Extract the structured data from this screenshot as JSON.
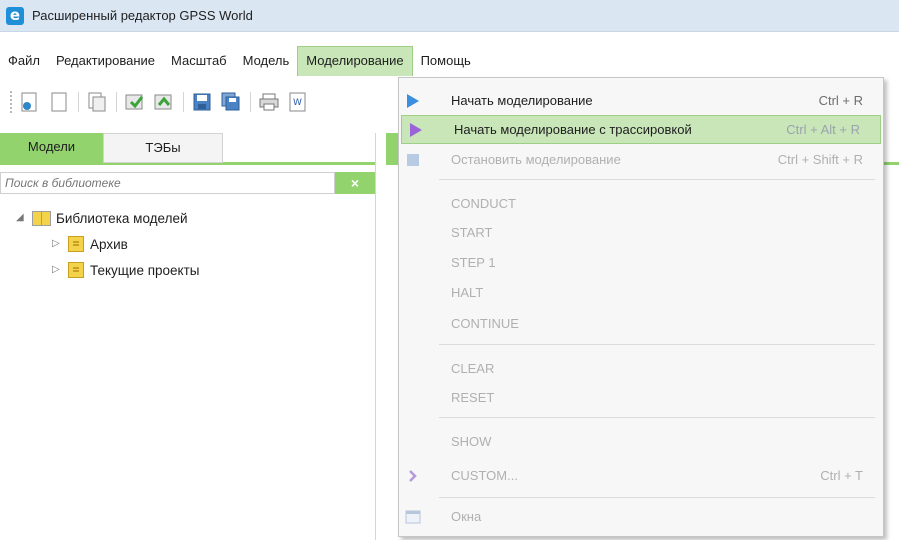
{
  "window": {
    "title": "Расширенный редактор GPSS World",
    "app_icon": "e"
  },
  "menubar": [
    {
      "label": "Файл"
    },
    {
      "label": "Редактирование"
    },
    {
      "label": "Масштаб"
    },
    {
      "label": "Модель"
    },
    {
      "label": "Моделирование",
      "active": true
    },
    {
      "label": "Помощь"
    }
  ],
  "toolbar": {
    "icons": [
      "new-model-icon",
      "blank-icon",
      "copy-icon",
      "import-icon",
      "export-icon",
      "save-icon",
      "save-all-icon",
      "print-icon",
      "word-icon"
    ]
  },
  "left_panel": {
    "tabs": [
      {
        "label": "Модели",
        "active": true
      },
      {
        "label": "ТЭБы",
        "active": false
      }
    ],
    "search": {
      "placeholder": "Поиск в библиотеке",
      "clear_label": "×"
    },
    "tree": {
      "root": {
        "label": "Библиотека моделей",
        "expanded": true
      },
      "children": [
        {
          "label": "Архив"
        },
        {
          "label": "Текущие проекты"
        }
      ]
    }
  },
  "dropdown": {
    "items": [
      {
        "type": "item",
        "label": "Начать моделирование",
        "shortcut": "Ctrl + R",
        "icon": "play-blue-icon"
      },
      {
        "type": "item",
        "label": "Начать моделирование с трассировкой",
        "shortcut": "Ctrl + Alt + R",
        "icon": "play-purple-icon",
        "highlight": true
      },
      {
        "type": "item",
        "label": "Остановить моделирование",
        "shortcut": "Ctrl + Shift + R",
        "icon": "stop-icon",
        "disabled": true
      },
      {
        "type": "sep"
      },
      {
        "type": "item",
        "label": "CONDUCT",
        "disabled": true
      },
      {
        "type": "item",
        "label": "START",
        "disabled": true
      },
      {
        "type": "item",
        "label": "STEP 1",
        "disabled": true
      },
      {
        "type": "item",
        "label": "HALT",
        "disabled": true
      },
      {
        "type": "item",
        "label": "CONTINUE",
        "disabled": true
      },
      {
        "type": "sep"
      },
      {
        "type": "item",
        "label": "CLEAR",
        "disabled": true
      },
      {
        "type": "item",
        "label": "RESET",
        "disabled": true
      },
      {
        "type": "sep"
      },
      {
        "type": "item",
        "label": "SHOW",
        "disabled": true
      },
      {
        "type": "item",
        "label": "CUSTOM...",
        "shortcut": "Ctrl + T",
        "icon": "chevron-right-icon",
        "disabled": true
      },
      {
        "type": "sep"
      },
      {
        "type": "item",
        "label": "Окна",
        "icon": "window-icon",
        "disabled": true
      }
    ]
  },
  "colors": {
    "accent_green": "#92d36e",
    "highlight_green": "#c9e6b9",
    "titlebar": "#dbe6f3"
  }
}
